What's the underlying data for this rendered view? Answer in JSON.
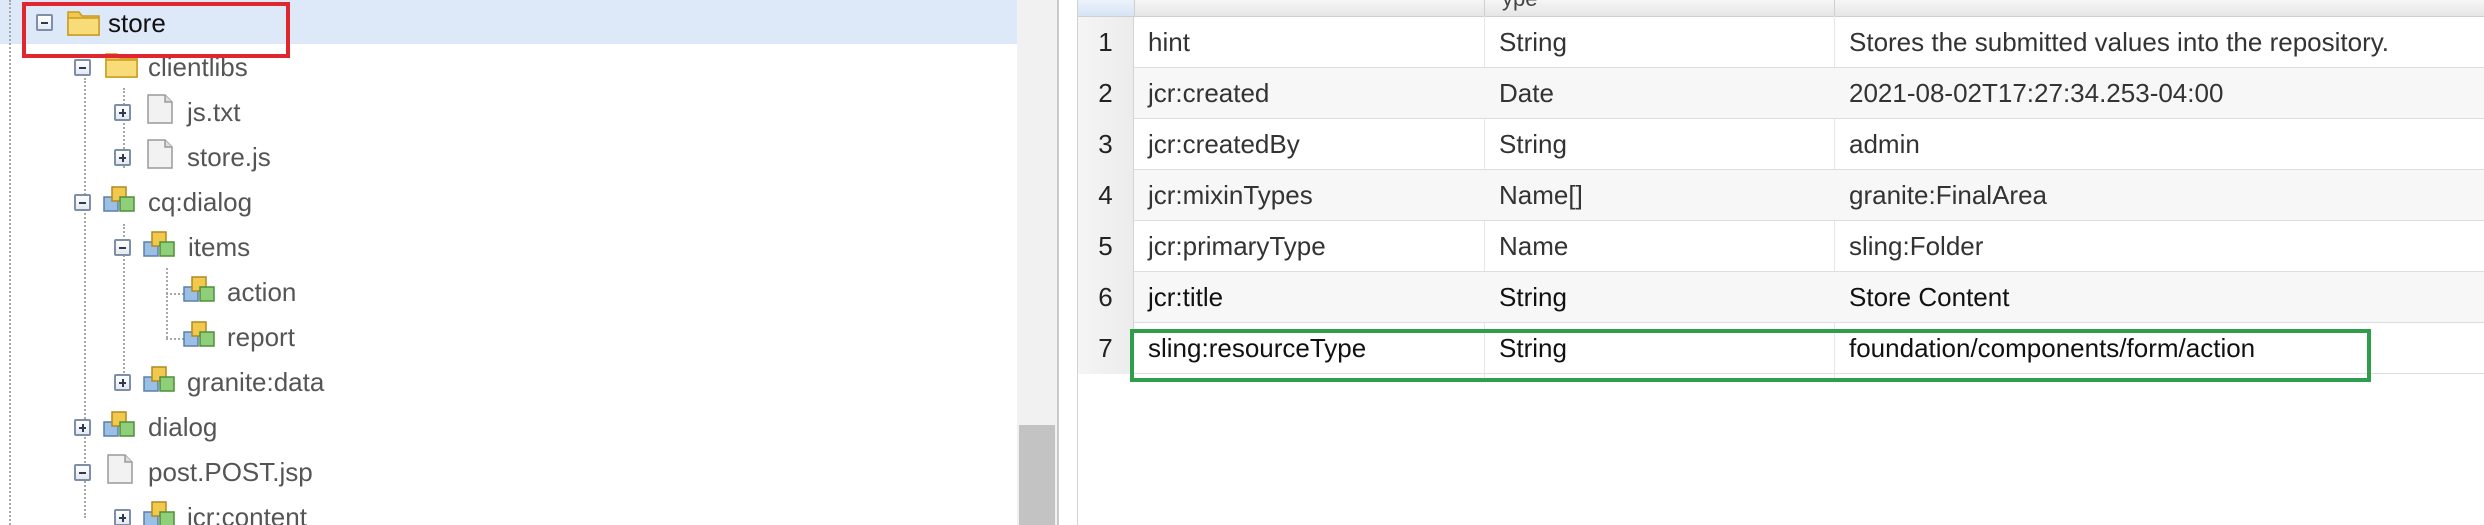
{
  "tree": {
    "nodes": [
      {
        "label": "store",
        "icon": "folder-icon",
        "expander": "minus",
        "selected": true
      },
      {
        "label": "clientlibs",
        "icon": "folder-icon",
        "expander": "minus"
      },
      {
        "label": "js.txt",
        "icon": "file-icon",
        "expander": "plus"
      },
      {
        "label": "store.js",
        "icon": "file-icon",
        "expander": "plus"
      },
      {
        "label": "cq:dialog",
        "icon": "node-icon",
        "expander": "minus"
      },
      {
        "label": "items",
        "icon": "node-icon",
        "expander": "minus"
      },
      {
        "label": "action",
        "icon": "node-icon",
        "expander": "none"
      },
      {
        "label": "report",
        "icon": "node-icon",
        "expander": "none"
      },
      {
        "label": "granite:data",
        "icon": "node-icon",
        "expander": "plus"
      },
      {
        "label": "dialog",
        "icon": "node-icon",
        "expander": "plus"
      },
      {
        "label": "post.POST.jsp",
        "icon": "file-icon",
        "expander": "minus"
      },
      {
        "label": "jcr:content",
        "icon": "node-icon",
        "expander": "plus"
      }
    ]
  },
  "properties": {
    "header_partial_text": "ype",
    "rows": [
      {
        "num": "1",
        "name": "hint",
        "type": "String",
        "value": "Stores the submitted values into the repository."
      },
      {
        "num": "2",
        "name": "jcr:created",
        "type": "Date",
        "value": "2021-08-02T17:27:34.253-04:00"
      },
      {
        "num": "3",
        "name": "jcr:createdBy",
        "type": "String",
        "value": "admin"
      },
      {
        "num": "4",
        "name": "jcr:mixinTypes",
        "type": "Name[]",
        "value": "granite:FinalArea"
      },
      {
        "num": "5",
        "name": "jcr:primaryType",
        "type": "Name",
        "value": "sling:Folder"
      },
      {
        "num": "6",
        "name": "jcr:title",
        "type": "String",
        "value": "Store Content"
      },
      {
        "num": "7",
        "name": "sling:resourceType",
        "type": "String",
        "value": "foundation/components/form/action"
      }
    ]
  },
  "colors": {
    "highlight_red": "#e0262f",
    "highlight_green": "#2e9e4c",
    "selection": "#dde8f8"
  }
}
